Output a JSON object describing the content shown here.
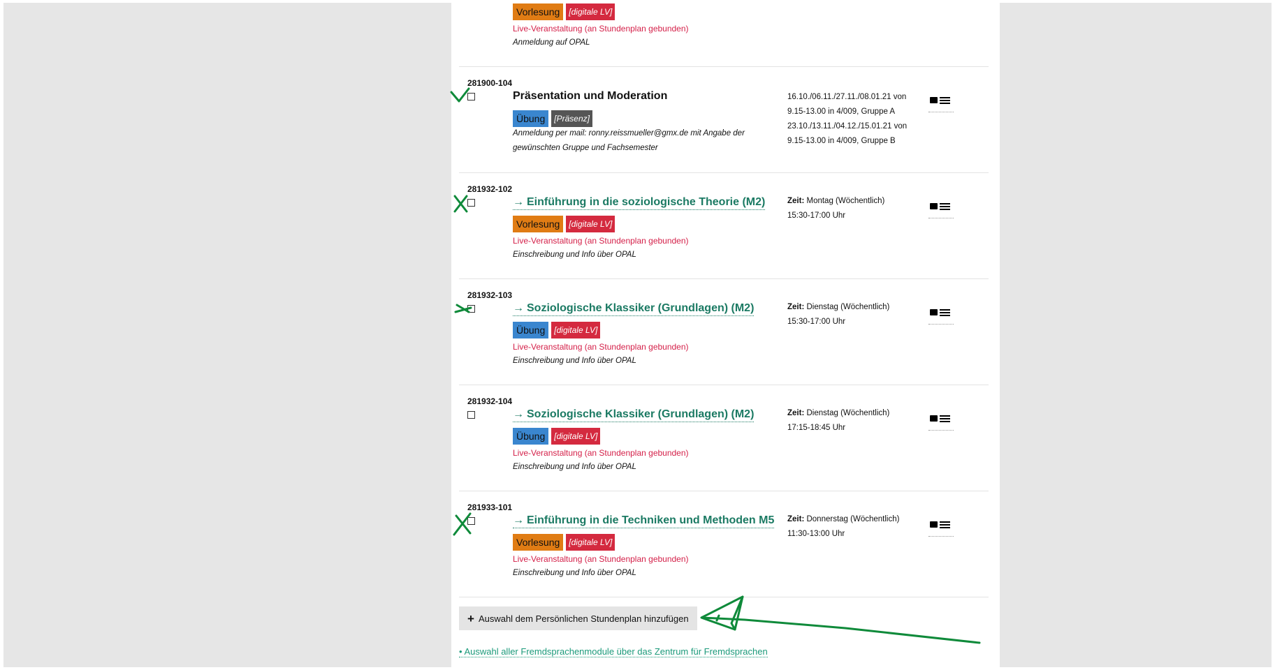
{
  "prev_course": {
    "type_badge": "Vorlesung",
    "format_badge": "[digitale LV]",
    "live_note": "Live-Veranstaltung (an Stundenplan gebunden)",
    "note": "Anmeldung auf OPAL"
  },
  "courses": [
    {
      "id": "281900-104",
      "title": "Präsentation und Moderation",
      "type_badge": "Übung",
      "format_badge": "[Präsenz]",
      "note": "Anmeldung per mail: ronny.reissmueller@gmx.de mit Angabe der gewünschten Gruppe und Fachsemester",
      "time_text": "16.10./06.11./27.11./08.01.21 von 9.15-13.00 in 4/009, Gruppe A 23.10./13.11./04.12./15.01.21 von 9.15-13.00 in 4/009, Gruppe B"
    },
    {
      "id": "281932-102",
      "arrow": "→",
      "title": "Einführung in die soziologische Theorie (M2)",
      "type_badge": "Vorlesung",
      "format_badge": "[digitale LV]",
      "live_note": "Live-Veranstaltung (an Stundenplan gebunden)",
      "note": "Einschreibung und Info über OPAL",
      "time_label": "Zeit:",
      "time_day": "Montag (Wöchentlich)",
      "time_hours": "15:30-17:00 Uhr"
    },
    {
      "id": "281932-103",
      "arrow": "→",
      "title": "Soziologische Klassiker (Grundlagen) (M2)",
      "type_badge": "Übung",
      "format_badge": "[digitale LV]",
      "live_note": "Live-Veranstaltung (an Stundenplan gebunden)",
      "note": "Einschreibung und Info über OPAL",
      "time_label": "Zeit:",
      "time_day": "Dienstag (Wöchentlich)",
      "time_hours": "15:30-17:00 Uhr"
    },
    {
      "id": "281932-104",
      "arrow": "→",
      "title": "Soziologische Klassiker (Grundlagen) (M2)",
      "type_badge": "Übung",
      "format_badge": "[digitale LV]",
      "live_note": "Live-Veranstaltung (an Stundenplan gebunden)",
      "note": "Einschreibung und Info über OPAL",
      "time_label": "Zeit:",
      "time_day": "Dienstag (Wöchentlich)",
      "time_hours": "17:15-18:45 Uhr"
    },
    {
      "id": "281933-101",
      "arrow": "→",
      "title": "Einführung in die Techniken und Methoden M5",
      "type_badge": "Vorlesung",
      "format_badge": "[digitale LV]",
      "live_note": "Live-Veranstaltung (an Stundenplan gebunden)",
      "note": "Einschreibung und Info über OPAL",
      "time_label": "Zeit:",
      "time_day": "Donnerstag (Wöchentlich)",
      "time_hours": "11:30-13:00 Uhr"
    }
  ],
  "add_button_label": "Auswahl dem Persönlichen Stundenplan hinzufügen",
  "lang_link": "• Auswahl aller Fremdsprachenmodule über das Zentrum für Fremdsprachen",
  "icons": {
    "add": "plus-icon",
    "row_action": "schedule-menu-icon",
    "title_link": "arrow-right-icon"
  },
  "colors": {
    "link_green": "#1b7a63",
    "vorlesung_orange": "#e07c14",
    "uebung_blue": "#3a86cf",
    "digital_red": "#d42a3f",
    "praesenz_gray": "#555555",
    "live_red": "#d41f48",
    "ink_green": "#0f8a3a"
  }
}
